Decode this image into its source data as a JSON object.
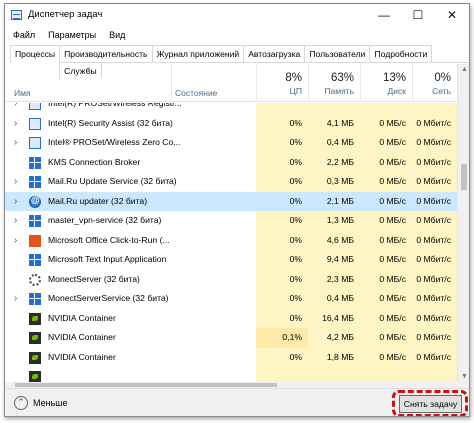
{
  "window": {
    "title": "Диспетчер задач",
    "minimize_glyph": "—",
    "maximize_glyph": "☐",
    "close_glyph": "✕"
  },
  "menu": [
    "Файл",
    "Параметры",
    "Вид"
  ],
  "tabs": [
    "Процессы",
    "Производительность",
    "Журнал приложений",
    "Автозагрузка",
    "Пользователи",
    "Подробности",
    "Службы"
  ],
  "active_tab": "Процессы",
  "columns": {
    "name": "Имя",
    "status": "Состояние",
    "cpu": {
      "pct": "8%",
      "label": "ЦП"
    },
    "memory": {
      "pct": "63%",
      "label": "Память"
    },
    "disk": {
      "pct": "13%",
      "label": "Диск"
    },
    "network": {
      "pct": "0%",
      "label": "Сеть"
    }
  },
  "processes": [
    {
      "name": "Intel(R) PROSet/Wireless Registr...",
      "expand": "›",
      "icon": "blue-square-icon",
      "status": "",
      "cpu": "",
      "mem": "",
      "disk": "",
      "net": ""
    },
    {
      "name": "Intel(R) Security Assist (32 бита)",
      "expand": "›",
      "icon": "blue-square-icon",
      "status": "",
      "cpu": "0%",
      "mem": "4,1 МБ",
      "disk": "0 МБ/с",
      "net": "0 Мбит/с"
    },
    {
      "name": "Intel® PROSet/Wireless Zero Co...",
      "expand": "›",
      "icon": "blue-square-icon",
      "status": "",
      "cpu": "0%",
      "mem": "0,4 МБ",
      "disk": "0 МБ/с",
      "net": "0 Мбит/с"
    },
    {
      "name": "KMS Connection Broker",
      "expand": "",
      "icon": "window-icon",
      "status": "",
      "cpu": "0%",
      "mem": "2,2 МБ",
      "disk": "0 МБ/с",
      "net": "0 Мбит/с"
    },
    {
      "name": "Mail.Ru Update Service (32 бита)",
      "expand": "›",
      "icon": "window-icon",
      "status": "",
      "cpu": "0%",
      "mem": "0,3 МБ",
      "disk": "0 МБ/с",
      "net": "0 Мбит/с"
    },
    {
      "name": "Mail.Ru updater (32 бита)",
      "expand": "›",
      "icon": "mail-icon",
      "status": "",
      "cpu": "0%",
      "mem": "2,1 МБ",
      "disk": "0 МБ/с",
      "net": "0 Мбит/с",
      "selected": true
    },
    {
      "name": "master_vpn-service (32 бита)",
      "expand": "›",
      "icon": "window-icon",
      "status": "",
      "cpu": "0%",
      "mem": "1,3 МБ",
      "disk": "0 МБ/с",
      "net": "0 Мбит/с"
    },
    {
      "name": "Microsoft Office Click-to-Run (...",
      "expand": "›",
      "icon": "office-icon",
      "status": "",
      "cpu": "0%",
      "mem": "4,6 МБ",
      "disk": "0 МБ/с",
      "net": "0 Мбит/с"
    },
    {
      "name": "Microsoft Text Input Application",
      "expand": "",
      "icon": "window-icon",
      "status": "",
      "cpu": "0%",
      "mem": "9,4 МБ",
      "disk": "0 МБ/с",
      "net": "0 Мбит/с"
    },
    {
      "name": "MonectServer (32 бита)",
      "expand": "",
      "icon": "gear-icon",
      "status": "",
      "cpu": "0%",
      "mem": "2,3 МБ",
      "disk": "0 МБ/с",
      "net": "0 Мбит/с"
    },
    {
      "name": "MonectServerService (32 бита)",
      "expand": "›",
      "icon": "window-icon",
      "status": "",
      "cpu": "0%",
      "mem": "0,4 МБ",
      "disk": "0 МБ/с",
      "net": "0 Мбит/с"
    },
    {
      "name": "NVIDIA Container",
      "expand": "",
      "icon": "nvidia-icon",
      "status": "",
      "cpu": "0%",
      "mem": "16,4 МБ",
      "disk": "0 МБ/с",
      "net": "0 Мбит/с"
    },
    {
      "name": "NVIDIA Container",
      "expand": "",
      "icon": "nvidia-icon",
      "status": "",
      "cpu": "0,1%",
      "mem": "4,2 МБ",
      "disk": "0 МБ/с",
      "net": "0 Мбит/с",
      "hot": true
    },
    {
      "name": "NVIDIA Container",
      "expand": "",
      "icon": "nvidia-icon",
      "status": "",
      "cpu": "0%",
      "mem": "1,8 МБ",
      "disk": "0 МБ/с",
      "net": "0 Мбит/с"
    },
    {
      "name": "",
      "expand": "",
      "icon": "nvidia-icon",
      "status": "",
      "cpu": "",
      "mem": "",
      "disk": "",
      "net": ""
    }
  ],
  "footer": {
    "less_label": "Меньше",
    "less_glyph": "⌃",
    "end_task_label": "Снять задачу"
  },
  "colors": {
    "highlight_ring": "#d10f0f",
    "selection": "#cce8ff",
    "heat": "#fff4c4"
  }
}
